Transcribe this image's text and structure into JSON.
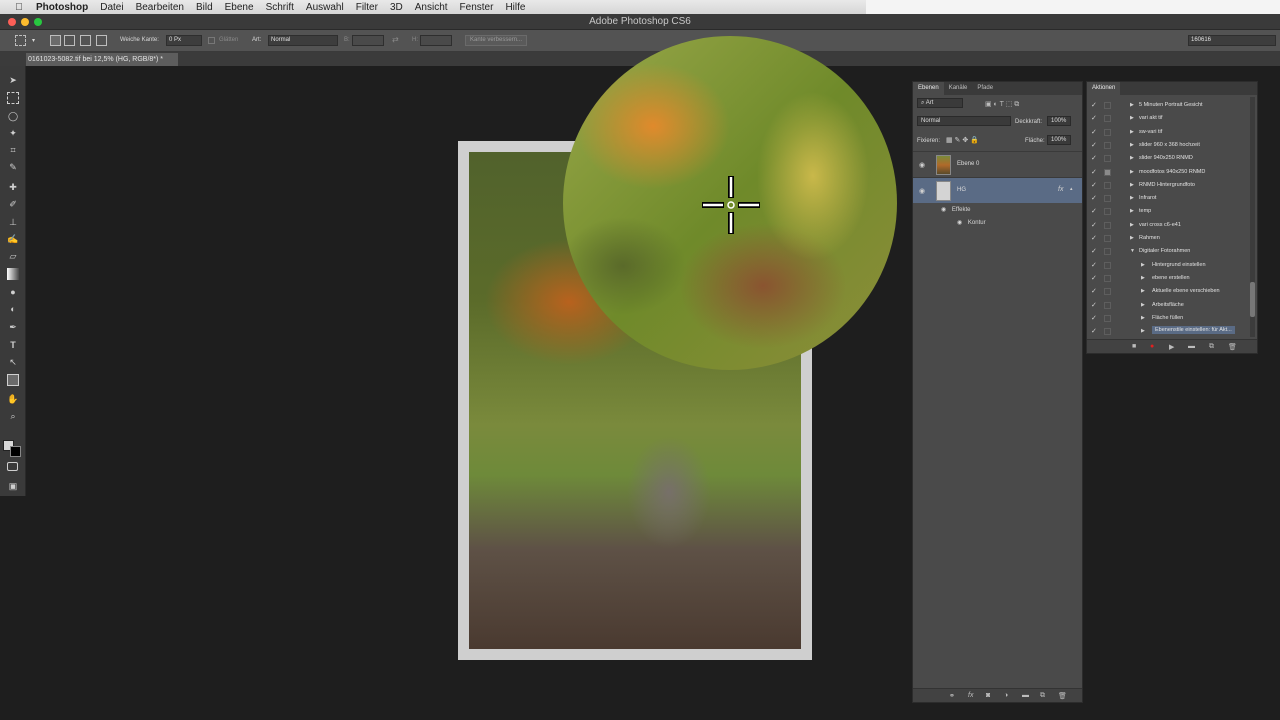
{
  "menubar": {
    "app": "Photoshop",
    "items": [
      "Datei",
      "Bearbeiten",
      "Bild",
      "Ebene",
      "Schrift",
      "Auswahl",
      "Filter",
      "3D",
      "Ansicht",
      "Fenster",
      "Hilfe"
    ]
  },
  "window": {
    "title": "Adobe Photoshop CS6"
  },
  "options": {
    "feather_label": "Weiche Kante:",
    "feather_value": "0 Px",
    "smooth_label": "Glätten",
    "style_label": "Art:",
    "style_value": "Normal",
    "width_label": "B:",
    "height_label": "H:",
    "refine_label": "Kante verbessern...",
    "workspace_value": "160616"
  },
  "document": {
    "tab": "0161023-5082.tif bei 12,5% (HG, RGB/8*) *"
  },
  "layers_panel": {
    "tabs": [
      "Ebenen",
      "Kanäle",
      "Pfade"
    ],
    "filter_label": "Art",
    "blend_mode": "Normal",
    "opacity_label": "Deckkraft:",
    "opacity_value": "100%",
    "lock_label": "Fixieren:",
    "fill_label": "Fläche:",
    "fill_value": "100%",
    "layers": [
      {
        "name": "Ebene 0"
      },
      {
        "name": "HG"
      }
    ],
    "effects_label": "Effekte",
    "effect_item": "Kontur",
    "fx": "fx"
  },
  "actions_panel": {
    "tab": "Aktionen",
    "items": [
      {
        "label": "5 Minuten Portrait Gesicht",
        "level": 1,
        "expanded": false
      },
      {
        "label": "vari akt tif",
        "level": 1,
        "expanded": false
      },
      {
        "label": "sw-vari tif",
        "level": 1,
        "expanded": false
      },
      {
        "label": "slider 960 x 368 hochzeit",
        "level": 1,
        "expanded": false
      },
      {
        "label": "slider 940x250 RNMD",
        "level": 1,
        "expanded": false
      },
      {
        "label": "moodfotos 940x250 RNMD",
        "level": 1,
        "expanded": false
      },
      {
        "label": "RNMD Hintergrundfoto",
        "level": 1,
        "expanded": false
      },
      {
        "label": "Infrarot",
        "level": 1,
        "expanded": false
      },
      {
        "label": "temp",
        "level": 1,
        "expanded": false
      },
      {
        "label": "vari cross c6-e41",
        "level": 1,
        "expanded": false
      },
      {
        "label": "Rahmen",
        "level": 1,
        "expanded": false
      },
      {
        "label": "Digitaler Fotorahmen",
        "level": 1,
        "expanded": true
      },
      {
        "label": "Hintergrund einstellen",
        "level": 2,
        "expanded": false
      },
      {
        "label": "ebene erstellen",
        "level": 2,
        "expanded": false
      },
      {
        "label": "Aktuelle ebene verschieben",
        "level": 2,
        "expanded": false
      },
      {
        "label": "Arbeitsfläche",
        "level": 2,
        "expanded": false
      },
      {
        "label": "Fläche füllen",
        "level": 2,
        "expanded": false
      },
      {
        "label": "Ebenenstile einstellen: für Akt...",
        "level": 2,
        "expanded": false
      }
    ]
  }
}
